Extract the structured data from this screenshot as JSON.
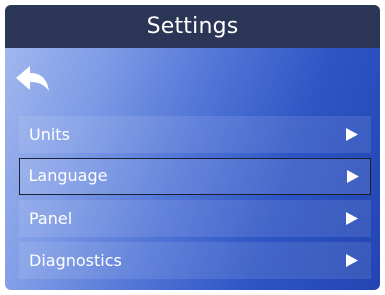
{
  "header": {
    "title": "Settings"
  },
  "nav": {
    "back_icon": "back-arrow-icon"
  },
  "menu": {
    "selected_index": 1,
    "items": [
      {
        "label": "Units",
        "icon": "chevron-right-icon"
      },
      {
        "label": "Language",
        "icon": "chevron-right-icon"
      },
      {
        "label": "Panel",
        "icon": "chevron-right-icon"
      },
      {
        "label": "Diagnostics",
        "icon": "chevron-right-icon"
      }
    ]
  },
  "colors": {
    "title_bar": "#2b3555",
    "background_light": "#a7bbee",
    "background_dark": "#2245b2",
    "text": "#ffffff",
    "selection_border": "#1b2236"
  }
}
